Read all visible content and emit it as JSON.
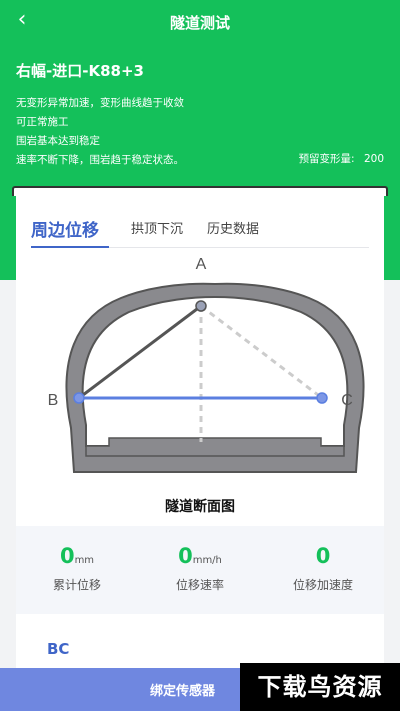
{
  "header": {
    "title": "隧道测试",
    "back_icon": "chevron-left-icon"
  },
  "summary": {
    "section": "右幅-进口-K88+3",
    "notes": [
      "无变形异常加速，变形曲线趋于收敛",
      "可正常施工",
      "围岩基本达到稳定",
      "速率不断下降，围岩趋于稳定状态。"
    ],
    "reserve_label": "预留变形量:",
    "reserve_value": "200"
  },
  "tabs": [
    {
      "label": "周边位移",
      "active": true
    },
    {
      "label": "拱顶下沉",
      "active": false
    },
    {
      "label": "历史数据",
      "active": false
    }
  ],
  "diagram": {
    "points": {
      "a": "A",
      "b": "B",
      "c": "C"
    },
    "caption": "隧道断面图"
  },
  "stats": [
    {
      "value": "0",
      "unit": "mm",
      "label": "累计位移"
    },
    {
      "value": "0",
      "unit": "mm/h",
      "label": "位移速率"
    },
    {
      "value": "0",
      "unit": "",
      "label": "位移加速度"
    }
  ],
  "detail": {
    "line_label": "BC"
  },
  "bottom": {
    "bind_label": "绑定传感器"
  },
  "watermark": "下载鸟资源",
  "colors": {
    "primary": "#14c05a",
    "accent": "#3f65c8",
    "bar": "#6f87e0"
  }
}
